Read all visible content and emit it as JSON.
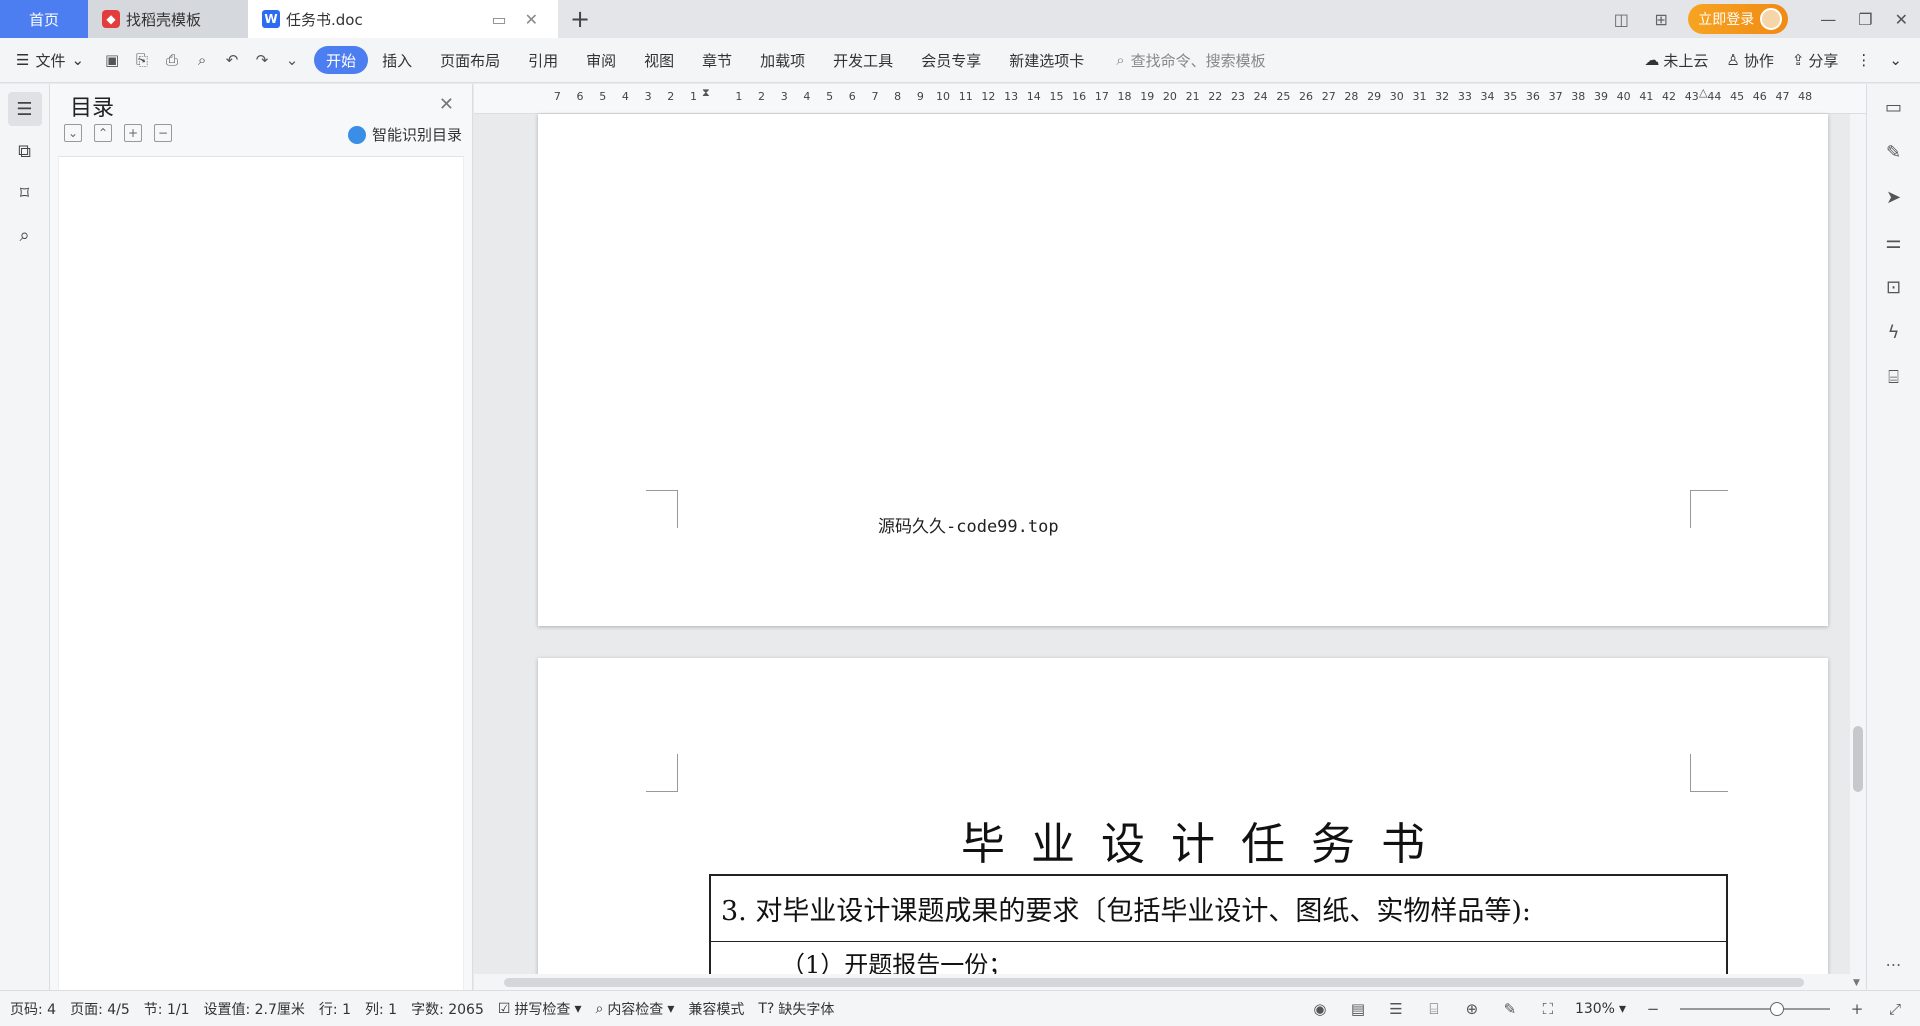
{
  "titlebar": {
    "tabs": [
      {
        "label": "首页"
      },
      {
        "label": "找稻壳模板"
      },
      {
        "label": "任务书.doc"
      }
    ],
    "login_label": "立即登录"
  },
  "ribbon": {
    "file_label": "文件",
    "tabs": [
      "开始",
      "插入",
      "页面布局",
      "引用",
      "审阅",
      "视图",
      "章节",
      "加载项",
      "开发工具",
      "会员专享",
      "新建选项卡"
    ],
    "search_placeholder": "查找命令、搜索模板",
    "cloud_label": "未上云",
    "collab_label": "协作",
    "share_label": "分享"
  },
  "toc": {
    "title": "目录",
    "smart_label": "智能识别目录"
  },
  "ruler": {
    "numbers": [
      "7",
      "6",
      "5",
      "4",
      "3",
      "2",
      "1",
      "",
      "1",
      "2",
      "3",
      "4",
      "5",
      "6",
      "7",
      "8",
      "9",
      "10",
      "11",
      "12",
      "13",
      "14",
      "15",
      "16",
      "17",
      "18",
      "19",
      "20",
      "21",
      "22",
      "23",
      "24",
      "25",
      "26",
      "27",
      "28",
      "29",
      "30",
      "31",
      "32",
      "33",
      "34",
      "35",
      "36",
      "37",
      "38",
      "39",
      "40",
      "41",
      "42",
      "43",
      "44",
      "45",
      "46",
      "47",
      "48"
    ]
  },
  "document": {
    "footer_text": "源码久久-code99.top",
    "title": "毕业设计任务书",
    "row1": "3. 对毕业设计课题成果的要求〔包括毕业设计、图纸、实物样品等):",
    "row2": "（1）开题报告一份；"
  },
  "statusbar": {
    "page_num": "页码: 4",
    "pages": "页面: 4/5",
    "section": "节: 1/1",
    "setting": "设置值: 2.7厘米",
    "row": "行: 1",
    "col": "列: 1",
    "word_count": "字数: 2065",
    "spell_check": "拼写检查",
    "content_check": "内容检查",
    "compat_mode": "兼容模式",
    "missing_font": "缺失字体",
    "zoom": "130%"
  }
}
